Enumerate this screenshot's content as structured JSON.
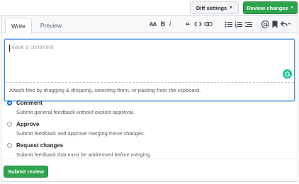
{
  "header": {
    "diff_settings_label": "Diff settings",
    "review_changes_label": "Review changes"
  },
  "tabs": {
    "write": "Write",
    "preview": "Preview"
  },
  "toolbar": {
    "heading_label": "AA",
    "bold_label": "B",
    "italic_label": "i",
    "quote_label": "“",
    "icons": [
      "header-icon",
      "bold-icon",
      "italic-icon",
      "quote-icon",
      "code-icon",
      "link-icon",
      "bulleted-list-icon",
      "numbered-list-icon",
      "task-list-icon",
      "mention-icon",
      "bookmark-icon",
      "reply-icon"
    ]
  },
  "editor": {
    "placeholder": "Leave a comment",
    "attach_hint": "Attach files by dragging & dropping, selecting them, or pasting from the clipboard."
  },
  "options": [
    {
      "label": "Comment",
      "description": "Submit general feedback without explicit approval.",
      "checked": true
    },
    {
      "label": "Approve",
      "description": "Submit feedback and approve merging these changes.",
      "checked": false
    },
    {
      "label": "Request changes",
      "description": "Submit feedback that must be addressed before merging.",
      "checked": false
    }
  ],
  "submit_label": "Submit review",
  "colors": {
    "primary_green": "#2ea44f",
    "focus_blue": "#4a8fd9",
    "radio_blue": "#0366d6"
  }
}
